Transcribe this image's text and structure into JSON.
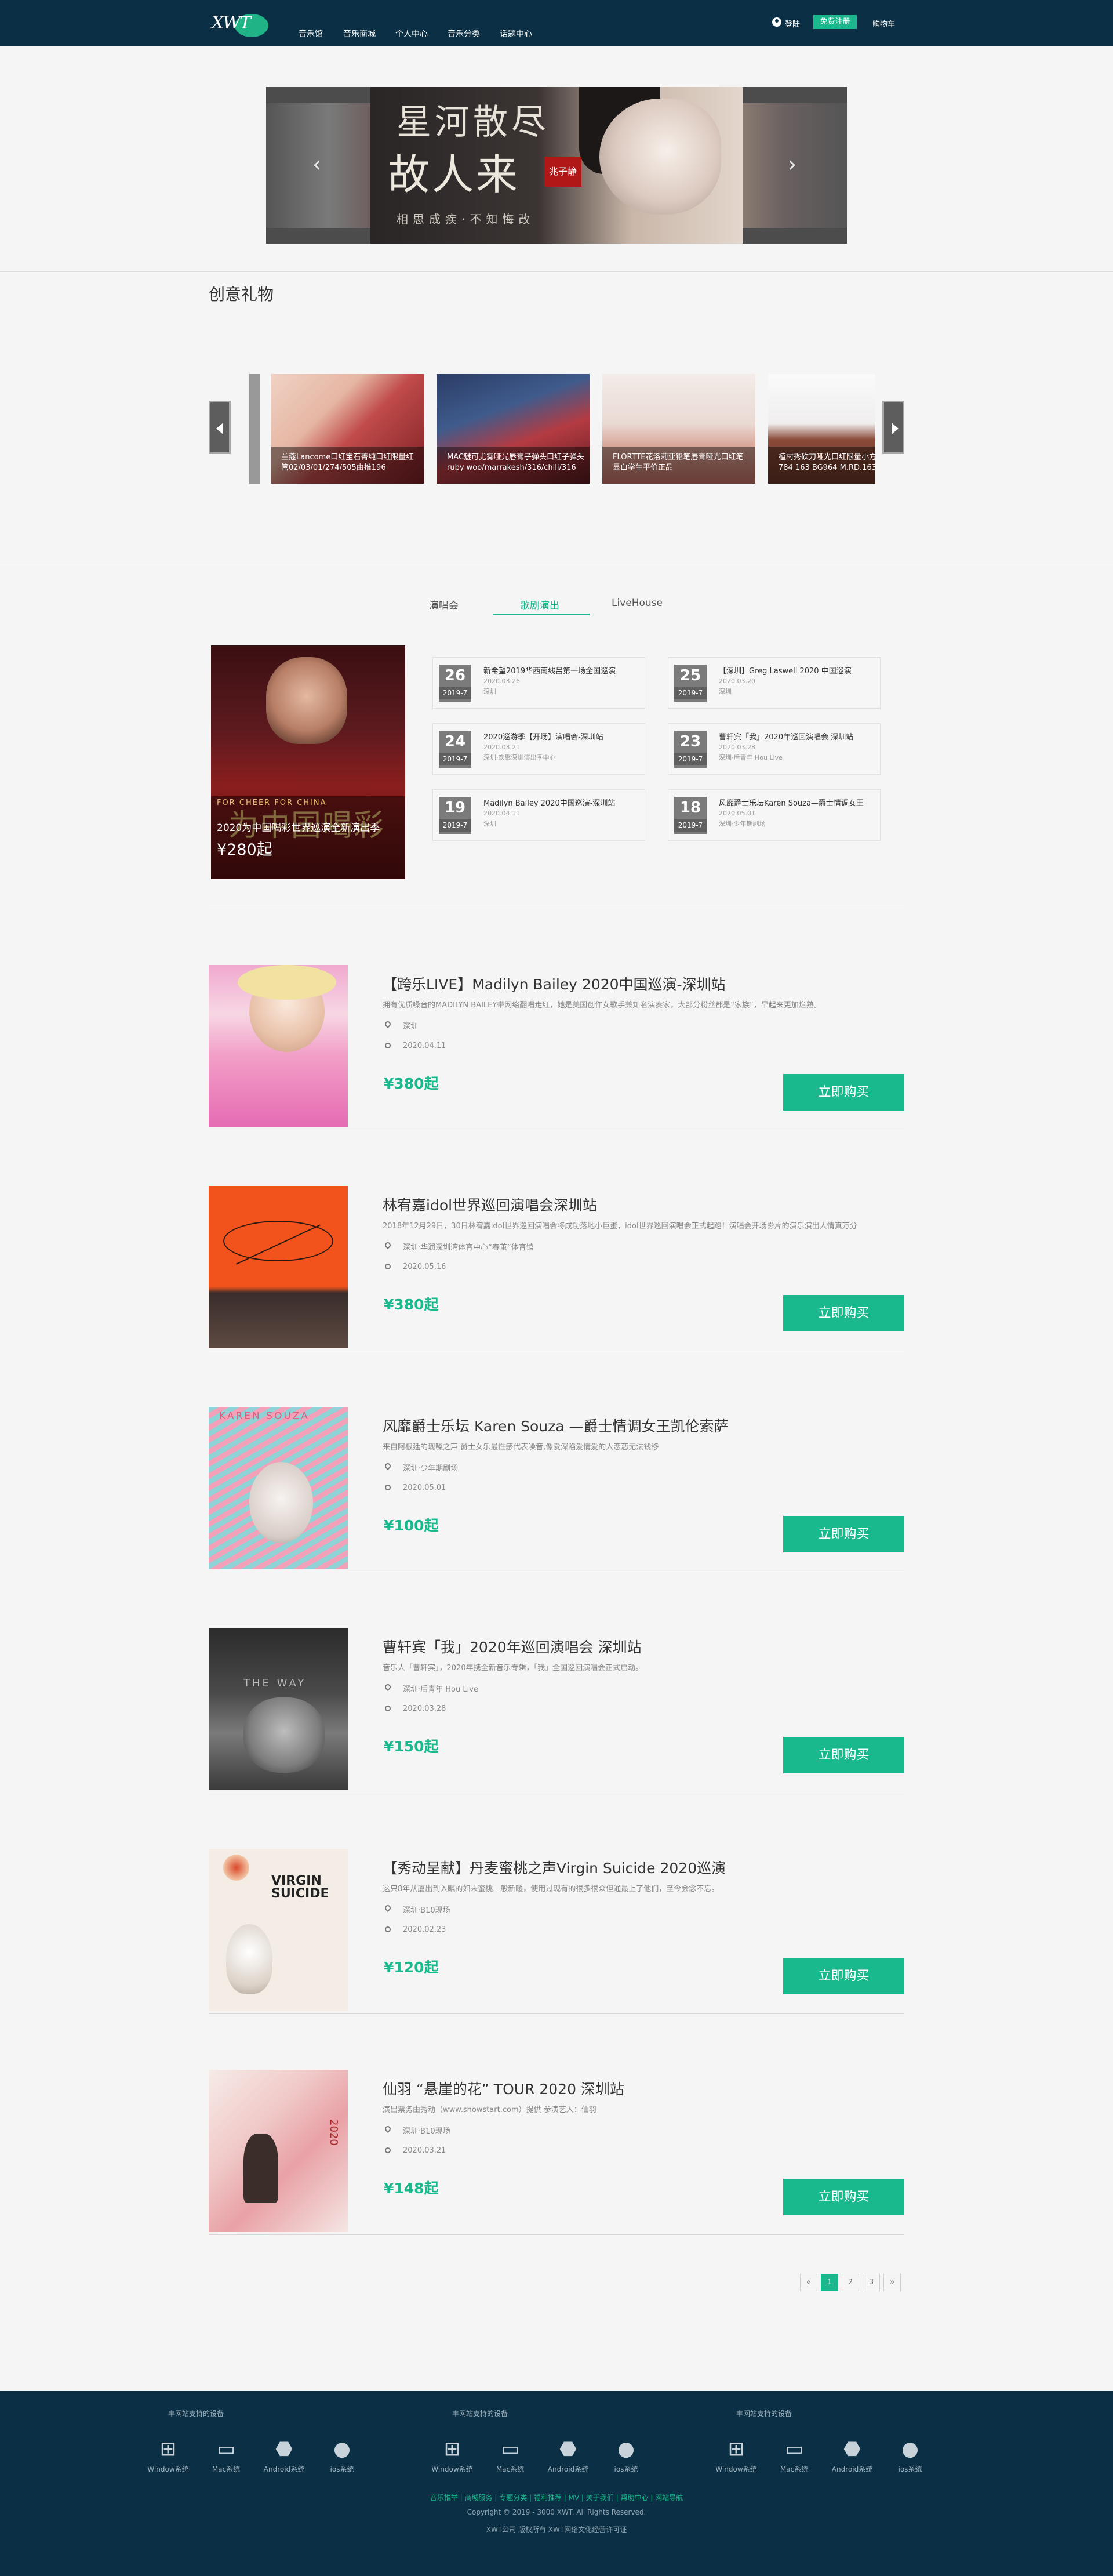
{
  "nav": {
    "logo_text": "XWT",
    "links": [
      "音乐馆",
      "音乐商城",
      "个人中心",
      "音乐分类",
      "话题中心"
    ],
    "login": "登陆",
    "register": "免费注册",
    "cart": "购物车"
  },
  "banner": {
    "line1": "星河散尽",
    "line2": "故人来",
    "seal": "兆子静",
    "line3": "相思成疾·不知悔改"
  },
  "gifts": {
    "title": "创意礼物",
    "items": [
      {
        "caption": "兰蔻Lancome口红宝石菁纯口红限量红管02/03/01/274/505由推196"
      },
      {
        "caption": "MAC魅可尤雾哑光唇膏子弹头口红子弹头ruby woo/marrakesh/316/chili/316"
      },
      {
        "caption": "FLORTTE花洛莉亚铅笔唇膏哑光口红笔显白学生平价正品"
      },
      {
        "caption": "植村秀砍刀哑光口红限量小方管M.BR 784 163 BG964 M.RD.163"
      }
    ],
    "colors": [
      "#c04a4a",
      "#3f5b8c",
      "#d9a79a",
      "#6b3728"
    ]
  },
  "tabs": {
    "items": [
      "演唱会",
      "歌剧演出",
      "LiveHouse"
    ],
    "active": 1
  },
  "featured": {
    "art_title": "为中国喝彩",
    "subtitle": "FOR CHEER FOR CHINA",
    "name": "2020为中国喝彩世界巡演全新演出季",
    "price": "¥280起"
  },
  "events": [
    {
      "day": "26",
      "ym": "2019-7",
      "title": "新希望2019华西南线吕第一场全国巡演",
      "date": "2020.03.26",
      "venue": "深圳"
    },
    {
      "day": "25",
      "ym": "2019-7",
      "title": "【深圳】Greg Laswell 2020 中国巡演",
      "date": "2020.03.20",
      "venue": "深圳"
    },
    {
      "day": "24",
      "ym": "2019-7",
      "title": "2020巡游季【开场】演唱会-深圳站",
      "date": "2020.03.21",
      "venue": "深圳·欢聚深圳演出季中心"
    },
    {
      "day": "23",
      "ym": "2019-7",
      "title": "曹轩宾「我」2020年巡回演唱会 深圳站",
      "date": "2020.03.28",
      "venue": "深圳·后青年 Hou Live"
    },
    {
      "day": "19",
      "ym": "2019-7",
      "title": "Madilyn Bailey 2020中国巡演-深圳站",
      "date": "2020.04.11",
      "venue": "深圳"
    },
    {
      "day": "18",
      "ym": "2019-7",
      "title": "风靡爵士乐坛Karen Souza—爵士情调女王",
      "date": "2020.05.01",
      "venue": "深圳·少年期剧场"
    }
  ],
  "list": [
    {
      "title": "【跨乐LIVE】Madilyn Bailey 2020中国巡演-深圳站",
      "desc": "拥有优质嗓音的MADILYN BAILEY带网络翻唱走红，她是美国创作女歌手兼知名演奏家，大部分粉丝都是“家族”，早起来更加烂熟。",
      "venue": "深圳",
      "date": "2020.04.11",
      "price": "¥380起",
      "buy": "立即购买"
    },
    {
      "title": "林宥嘉idol世界巡回演唱会深圳站",
      "desc": "2018年12月29日，30日林宥嘉idol世界巡回演唱会将成功落地小巨蛋，idol世界巡回演唱会正式起跑！演唱会开场影片的演乐演出人情真万分",
      "venue": "深圳·华润深圳湾体育中心“春茧”体育馆",
      "date": "2020.05.16",
      "price": "¥380起",
      "buy": "立即购买"
    },
    {
      "title": "风靡爵士乐坛 Karen Souza —爵士情调女王凯伦索萨",
      "desc": "来自阿根廷的现嗓之声 爵士女乐最性感代表嗓音,像爱深陷爱情爱的人恋恋无法钱移",
      "venue": "深圳·少年期剧场",
      "date": "2020.05.01",
      "price": "¥100起",
      "buy": "立即购买"
    },
    {
      "title": "曹轩宾「我」2020年巡回演唱会 深圳站",
      "desc": "音乐人「曹轩宾」，2020年携全新音乐专辑，「我」全国巡回演唱会正式启动。",
      "venue": "深圳·后青年 Hou Live",
      "date": "2020.03.28",
      "price": "¥150起",
      "buy": "立即购买"
    },
    {
      "title": "【秀动呈献】丹麦蜜桃之声Virgin Suicide 2020巡演",
      "desc": "这只8年从厦出到入瞩的如未蜜桃—般新暖，使用过现有的很多很众但通最上了他们，至今会念不忘。",
      "venue": "深圳·B10现场",
      "date": "2020.02.23",
      "price": "¥120起",
      "buy": "立即购买"
    },
    {
      "title": "仙羽 “悬崖的花” TOUR 2020 深圳站",
      "desc": "演出票务由秀动（www.showstart.com）提供 参演艺人：仙羽",
      "venue": "深圳·B10现场",
      "date": "2020.03.21",
      "price": "¥148起",
      "buy": "立即购买"
    }
  ],
  "list_art": [
    "KAREN SOUZA",
    "THE WAY",
    "VIRGIN SUICIDE",
    "2020"
  ],
  "pager": [
    "«",
    "1",
    "2",
    "3",
    "»"
  ],
  "footer": {
    "col_title": "丰网站支持的设备",
    "devices": [
      "Window系统",
      "Mac系统",
      "Android系统",
      "ios系统"
    ],
    "links": "音乐推举 | 商城服务 | 专题分类 | 福利推荐 | MV | 关于我们 | 帮助中心 | 网站导航",
    "copyright": "Copyright © 2019 - 3000 XWT. All Rights Reserved.",
    "record": "XWT公司 版权所有 XWT网络文化经营许可证"
  },
  "colors": {
    "brand": "#19b98d",
    "nav_bg": "#0b3045"
  }
}
